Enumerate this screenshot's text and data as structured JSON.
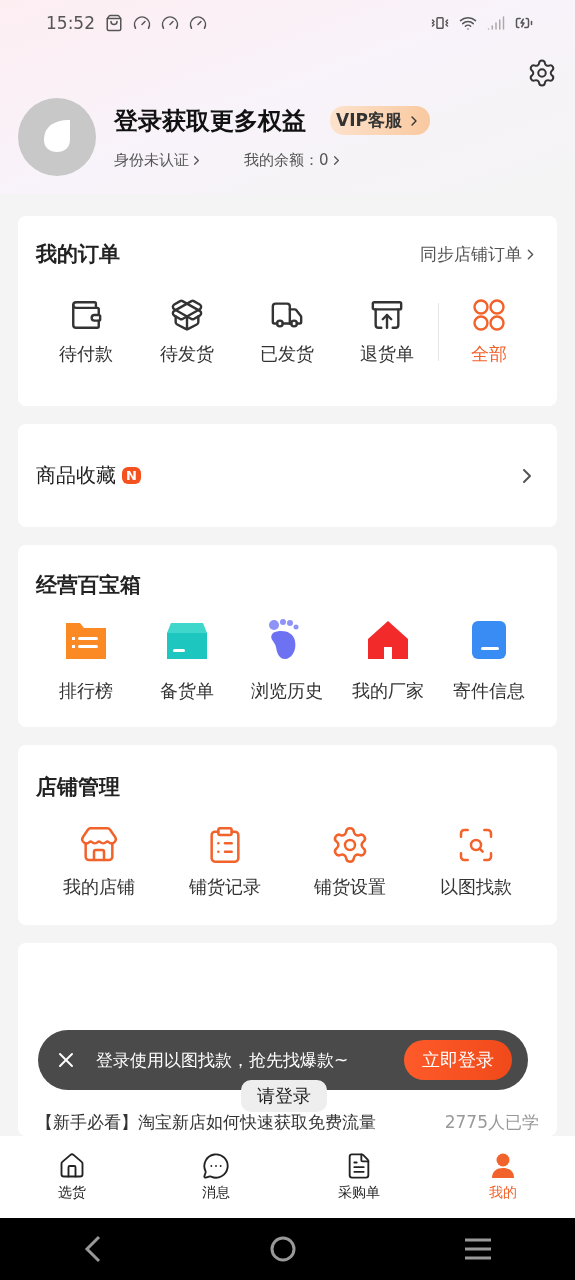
{
  "status_bar": {
    "time": "15:52"
  },
  "profile": {
    "title": "登录获取更多权益",
    "vip_label": "VIP客服",
    "identity": "身份未认证",
    "balance": "我的余额：0"
  },
  "orders": {
    "title": "我的订单",
    "link": "同步店铺订单",
    "items": [
      {
        "label": "待付款",
        "kind": "status"
      },
      {
        "label": "待发货",
        "kind": "status"
      },
      {
        "label": "已发货",
        "kind": "status"
      },
      {
        "label": "退货单",
        "kind": "status"
      },
      {
        "label": "全部",
        "kind": "all"
      }
    ]
  },
  "favorites": {
    "label": "商品收藏",
    "badge": "N"
  },
  "toolbox": {
    "title": "经营百宝箱",
    "items": [
      {
        "label": "排行榜"
      },
      {
        "label": "备货单"
      },
      {
        "label": "浏览历史"
      },
      {
        "label": "我的厂家"
      },
      {
        "label": "寄件信息"
      }
    ]
  },
  "store": {
    "title": "店铺管理",
    "items": [
      {
        "label": "我的店铺"
      },
      {
        "label": "铺货记录"
      },
      {
        "label": "铺货设置"
      },
      {
        "label": "以图找款"
      }
    ]
  },
  "learn": {
    "article": "【新手必看】淘宝新店如何快速获取免费流量",
    "learners": "2775人已学"
  },
  "toast": {
    "message": "登录使用以图找款，抢先找爆款~",
    "button": "立即登录"
  },
  "login_hint": "请登录",
  "tabs": [
    {
      "label": "选货",
      "selected": false
    },
    {
      "label": "消息",
      "selected": false
    },
    {
      "label": "采购单",
      "selected": false
    },
    {
      "label": "我的",
      "selected": true
    }
  ]
}
